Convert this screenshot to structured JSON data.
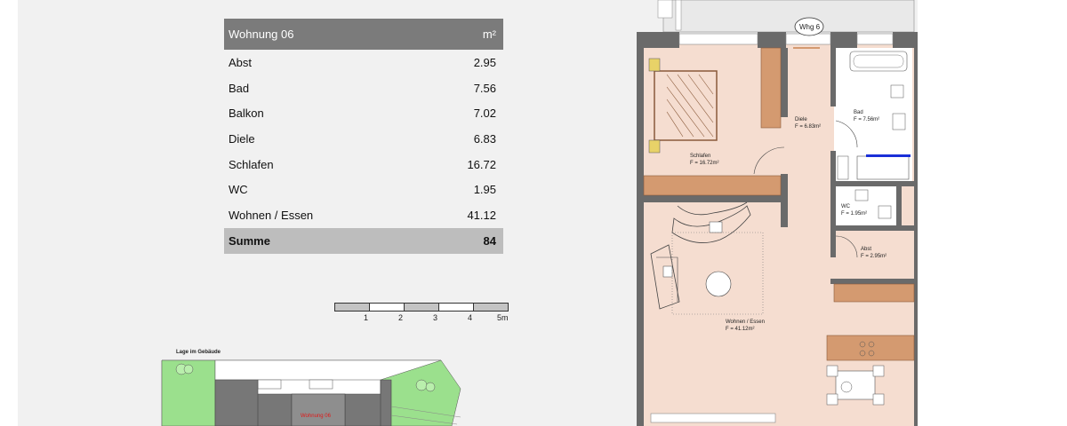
{
  "area_table": {
    "title": "Wohnung 06",
    "unit": "m²",
    "rows": [
      {
        "name": "Abst",
        "value": "2.95"
      },
      {
        "name": "Bad",
        "value": "7.56"
      },
      {
        "name": "Balkon",
        "value": "7.02"
      },
      {
        "name": "Diele",
        "value": "6.83"
      },
      {
        "name": "Schlafen",
        "value": "16.72"
      },
      {
        "name": "WC",
        "value": "1.95"
      },
      {
        "name": "Wohnen / Essen",
        "value": "41.12"
      }
    ],
    "sum_label": "Summe",
    "sum_value": "84"
  },
  "scale_bar": {
    "labels": [
      "1",
      "2",
      "3",
      "4",
      "5m"
    ]
  },
  "location_plan": {
    "title": "Lage im Gebäude",
    "unit_label": "Wohnung 06"
  },
  "floorplan": {
    "unit_tag": "Whg 6",
    "rooms": {
      "diele": {
        "name": "Diele",
        "area": "F = 6.83m²"
      },
      "bad": {
        "name": "Bad",
        "area": "F = 7.56m²"
      },
      "schlafen": {
        "name": "Schlafen",
        "area": "F = 16.72m²"
      },
      "wc": {
        "name": "WC",
        "area": "F = 1.95m²"
      },
      "abst": {
        "name": "Abst",
        "area": "F = 2.95m²"
      },
      "wohnen": {
        "name": "Wohnen / Essen",
        "area": "F = 41.12m²"
      }
    }
  },
  "colors": {
    "sheet_bg": "#f1f1f1",
    "table_header": "#7b7b7b",
    "table_sum": "#bdbdbd",
    "room_floor": "#f5ddd0",
    "wall": "#6a6a6a",
    "furniture_wood": "#d49a70",
    "grass": "#9be08d",
    "building": "#777777",
    "marker_blue": "#1a2fd8",
    "label_red": "#e01818"
  }
}
